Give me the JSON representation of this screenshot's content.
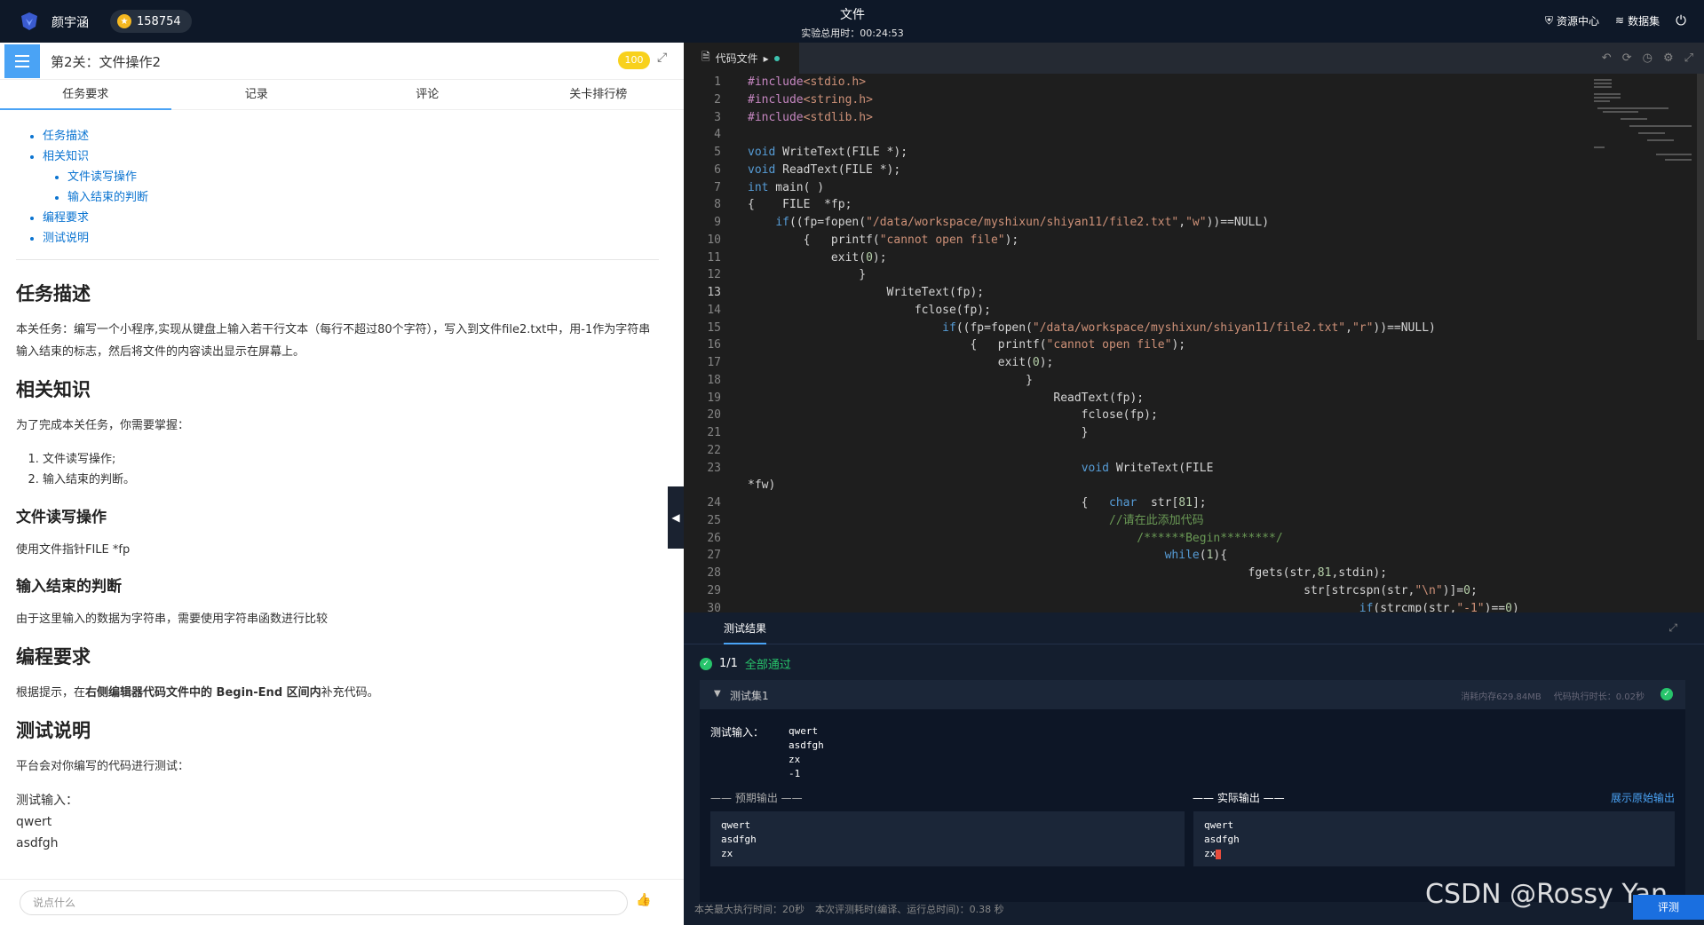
{
  "topbar": {
    "username": "颜宇涵",
    "coins": "158754",
    "title": "文件",
    "timer": "实验总用时：00:24:53",
    "resource_center": "资源中心",
    "dataset": "数据集"
  },
  "left": {
    "title": "第2关：文件操作2",
    "score": "100",
    "tabs": [
      "任务要求",
      "记录",
      "评论",
      "关卡排行榜"
    ],
    "toc": [
      "任务描述",
      "相关知识",
      "文件读写操作",
      "输入结束的判断",
      "编程要求",
      "测试说明"
    ],
    "h_task": "任务描述",
    "p_task": "本关任务：编写一个小程序,实现从键盘上输入若干行文本（每行不超过80个字符），写入到文件file2.txt中，用-1作为字符串输入结束的标志，然后将文件的内容读出显示在屏幕上。",
    "h_knowledge": "相关知识",
    "p_knowledge": "为了完成本关任务，你需要掌握：",
    "know_items": [
      "文件读写操作;",
      "输入结束的判断。"
    ],
    "h_rw": "文件读写操作",
    "p_rw": "使用文件指针FILE *fp",
    "h_end": "输入结束的判断",
    "p_end": "由于这里输入的数据为字符串，需要使用字符串函数进行比较",
    "h_req": "编程要求",
    "p_req_pre": "根据提示，在",
    "p_req_bold": "右侧编辑器代码文件中的 Begin-End 区间内",
    "p_req_post": "补充代码。",
    "h_test": "测试说明",
    "p_test": "平台会对你编写的代码进行测试：",
    "test_input_label": "测试输入：",
    "test_input_lines": [
      "qwert",
      "asdfgh"
    ],
    "comment_placeholder": "说点什么"
  },
  "editor": {
    "tab_label": "代码文件"
  },
  "result": {
    "tab": "测试结果",
    "count": "1/1",
    "all_pass": "全部通过",
    "set_name": "测试集1",
    "mem": "消耗内存629.84MB",
    "time": "代码执行时长：0.02秒",
    "input_label": "测试输入：",
    "input_value": "qwert\nasdfgh\nzx\n-1",
    "expected_label": "—— 预期输出 ——",
    "actual_label": "—— 实际输出 ——",
    "raw_link": "展示原始输出",
    "expected_value": "qwert\nasdfgh\nzx",
    "actual_value": "qwert\nasdfgh\nzx",
    "footer_max": "本关最大执行时间：20秒",
    "footer_this": "本次评测耗时(编译、运行总时间)：0.38 秒"
  },
  "watermark": "CSDN @Rossy Yan",
  "run_label": "评测"
}
